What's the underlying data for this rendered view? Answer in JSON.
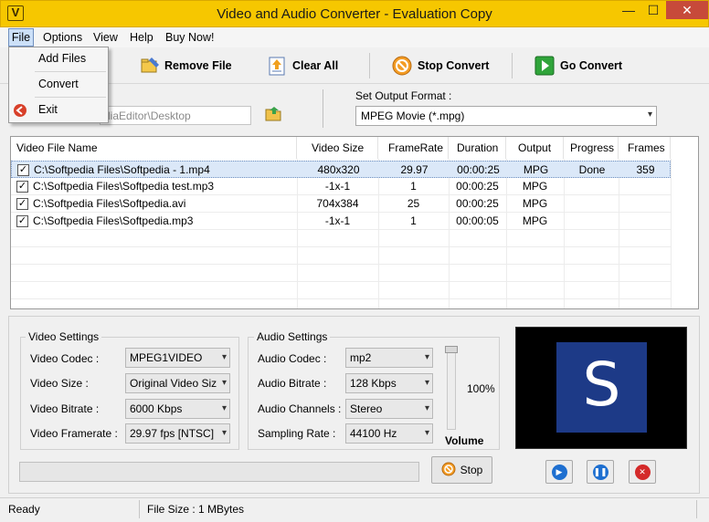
{
  "window": {
    "title": "Video and Audio Converter - Evaluation Copy",
    "app_icon_letter": "V",
    "minimize": "—",
    "maximize": "☐",
    "close": "✕"
  },
  "menu": {
    "items": [
      "File",
      "Options",
      "View",
      "Help",
      "Buy Now!"
    ],
    "file_dropdown": [
      "Add Files",
      "Convert",
      "Exit"
    ]
  },
  "toolbar": {
    "add_files": "Add Files",
    "remove_file": "Remove File",
    "clear_all": "Clear All",
    "stop_convert": "Stop Convert",
    "go_convert": "Go Convert"
  },
  "output": {
    "path_value": "diaEditor\\Desktop",
    "format_label": "Set Output Format :",
    "format_value": "MPEG Movie (*.mpg)"
  },
  "file_list": {
    "columns": [
      "Video File Name",
      "Video Size",
      "FrameRate",
      "Duration",
      "Output",
      "Progress",
      "Frames"
    ],
    "rows": [
      {
        "checked": true,
        "name": "C:\\Softpedia Files\\Softpedia - 1.mp4",
        "size": "480x320",
        "framerate": "29.97",
        "duration": "00:00:25",
        "output": "MPG",
        "progress": "Done",
        "frames": "359",
        "selected": true
      },
      {
        "checked": true,
        "name": "C:\\Softpedia Files\\Softpedia test.mp3",
        "size": "-1x-1",
        "framerate": "1",
        "duration": "00:00:25",
        "output": "MPG",
        "progress": "",
        "frames": "",
        "selected": false
      },
      {
        "checked": true,
        "name": "C:\\Softpedia Files\\Softpedia.avi",
        "size": "704x384",
        "framerate": "25",
        "duration": "00:00:25",
        "output": "MPG",
        "progress": "",
        "frames": "",
        "selected": false
      },
      {
        "checked": true,
        "name": "C:\\Softpedia Files\\Softpedia.mp3",
        "size": "-1x-1",
        "framerate": "1",
        "duration": "00:00:05",
        "output": "MPG",
        "progress": "",
        "frames": "",
        "selected": false
      }
    ]
  },
  "video_settings": {
    "title": "Video Settings",
    "codec_label": "Video Codec :",
    "codec_value": "MPEG1VIDEO",
    "size_label": "Video Size :",
    "size_value": "Original Video Siz",
    "bitrate_label": "Video Bitrate :",
    "bitrate_value": "6000 Kbps",
    "framerate_label": "Video Framerate :",
    "framerate_value": "29.97 fps [NTSC]"
  },
  "audio_settings": {
    "title": "Audio Settings",
    "codec_label": "Audio Codec :",
    "codec_value": "mp2",
    "bitrate_label": "Audio Bitrate :",
    "bitrate_value": "128 Kbps",
    "channels_label": "Audio Channels :",
    "channels_value": "Stereo",
    "sampling_label": "Sampling Rate :",
    "sampling_value": "44100 Hz"
  },
  "volume": {
    "label": "Volume",
    "percent": "100%"
  },
  "controls": {
    "stop_label": "Stop"
  },
  "preview": {
    "logo_letter": "S"
  },
  "status": {
    "state": "Ready",
    "file_size": "File Size : 1 MBytes"
  },
  "colors": {
    "titlebar": "#f6c700",
    "selection": "#dbe8f8",
    "preview_logo_bg": "#1d3a87"
  }
}
